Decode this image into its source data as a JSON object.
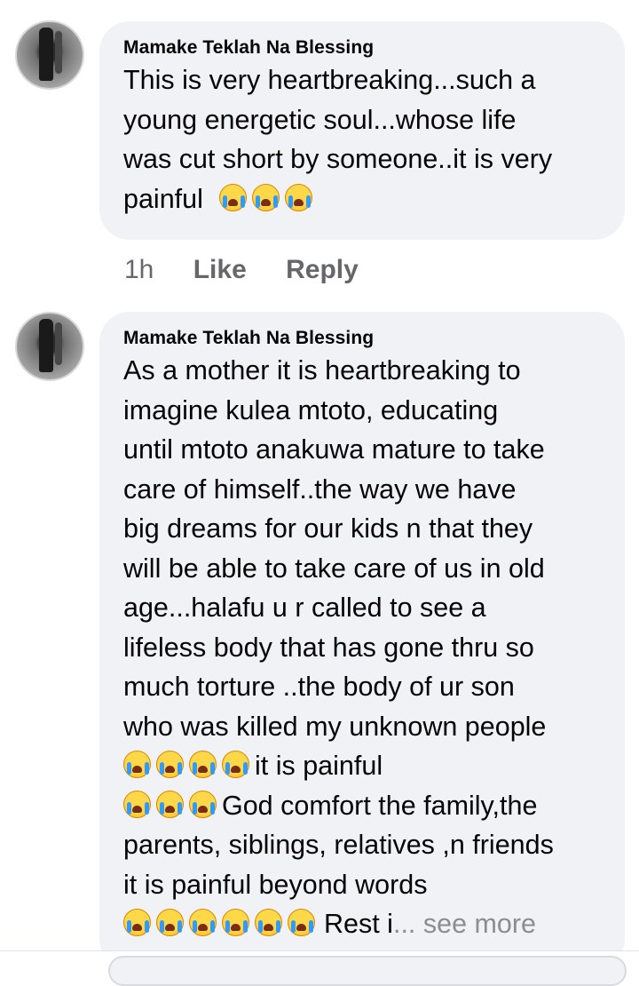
{
  "comments": [
    {
      "author": "Mamake Teklah Na Blessing",
      "lines": [
        "This is very heartbreaking...such a",
        "young energetic soul...whose life",
        "was cut short by someone..it is very",
        "painful"
      ],
      "time": "1h",
      "like": "Like",
      "reply": "Reply"
    },
    {
      "author": "Mamake Teklah Na Blessing",
      "lines": [
        "As a mother it is heartbreaking to",
        "imagine kulea mtoto, educating",
        "until mtoto anakuwa mature to take",
        "care of himself..the way we have",
        "big dreams for our kids n that they",
        "will be able to take care of us in old",
        "age...halafu u r called to see a",
        "lifeless body that has gone thru so",
        "much torture ..the body of ur son",
        "who was killed my unknown people",
        "it is painful",
        "God comfort the family,the",
        "parents, siblings, relatives ,n friends",
        "it is painful beyond words",
        "Rest i"
      ],
      "see_more": "... see more"
    }
  ],
  "icons": {
    "emoji": "loudly-crying-face-icon",
    "avatar": "profile-photo"
  },
  "colors": {
    "bubble": "#f0f2f5",
    "text": "#050505",
    "meta": "#65676b",
    "see_more": "#8a8d91"
  }
}
